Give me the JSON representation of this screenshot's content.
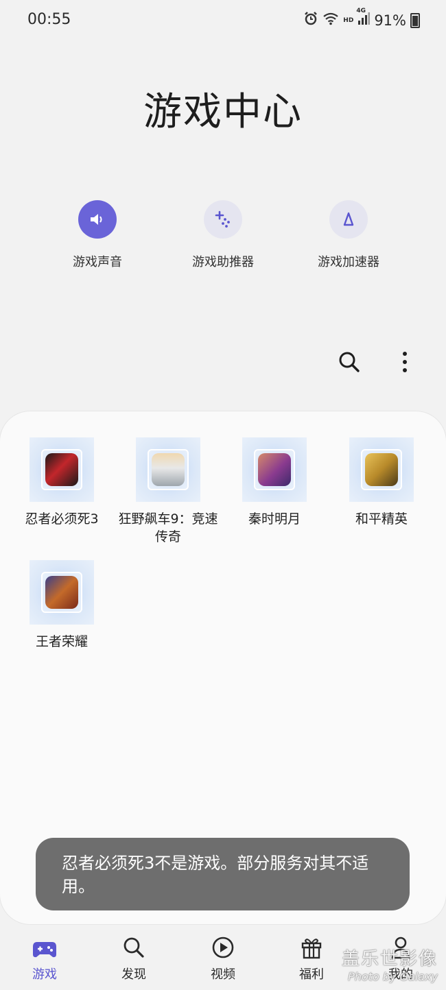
{
  "status": {
    "time": "00:55",
    "hd": "HD",
    "network": "4G",
    "battery_percent": "91%"
  },
  "page_title": "游戏中心",
  "quick_actions": [
    {
      "label": "游戏声音",
      "icon": "volume-icon",
      "active": true
    },
    {
      "label": "游戏助推器",
      "icon": "sparkle-icon",
      "active": false
    },
    {
      "label": "游戏加速器",
      "icon": "accelerator-icon",
      "active": false
    }
  ],
  "toolbar": {
    "search_icon": "search-icon",
    "more_icon": "more-vertical-icon"
  },
  "games": [
    {
      "name": "忍者必须死3",
      "icon_color": "#c2262b"
    },
    {
      "name": "狂野飙车9：竞速传奇",
      "icon_color": "#d9d9d9"
    },
    {
      "name": "秦时明月",
      "icon_color": "#8a3b8f"
    },
    {
      "name": "和平精英",
      "icon_color": "#b88a2a"
    },
    {
      "name": "王者荣耀",
      "icon_color": "#c46a2a"
    }
  ],
  "toast": {
    "message": "忍者必须死3不是游戏。部分服务对其不适用。"
  },
  "bottom_nav": [
    {
      "label": "游戏",
      "icon": "gamepad-icon",
      "active": true
    },
    {
      "label": "发现",
      "icon": "search-icon",
      "active": false
    },
    {
      "label": "视频",
      "icon": "play-circle-icon",
      "active": false
    },
    {
      "label": "福利",
      "icon": "gift-icon",
      "active": false
    },
    {
      "label": "我的",
      "icon": "person-icon",
      "active": false
    }
  ],
  "watermark": {
    "line1": "盖乐世影像",
    "line2": "Photo by Galaxy"
  },
  "colors": {
    "accent": "#6a64d8",
    "toast_bg": "#6e6e6e",
    "background": "#f2f2f2"
  }
}
